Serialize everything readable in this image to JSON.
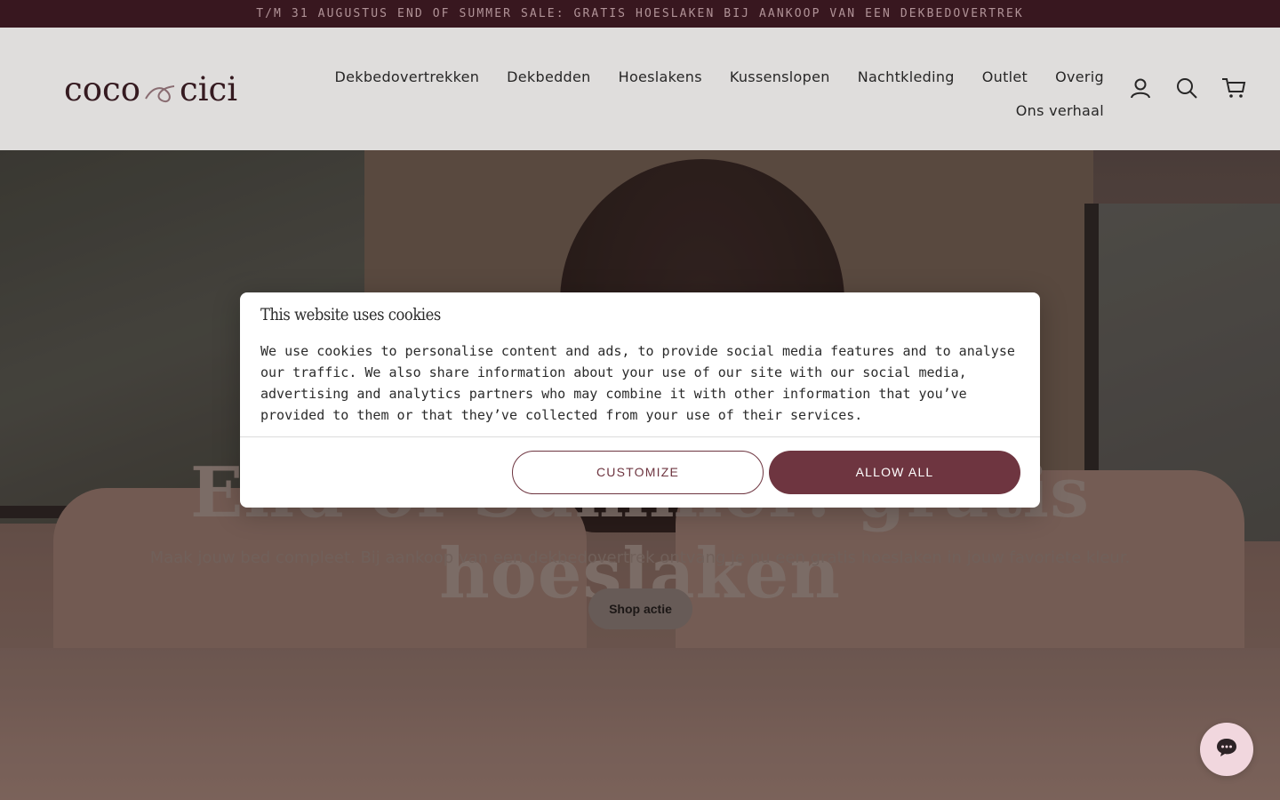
{
  "announcement": {
    "text": "T/M 31 AUGUSTUS END OF SUMMER SALE: GRATIS HOESLAKEN BIJ AANKOOP VAN EEN DEKBEDOVERTREK"
  },
  "header": {
    "logo": {
      "part1": "coco",
      "part2": "cici",
      "ampersand_icon": "ampersand-icon"
    },
    "nav_row1": [
      {
        "label": "Dekbedovertrekken"
      },
      {
        "label": "Dekbedden"
      },
      {
        "label": "Hoeslakens"
      },
      {
        "label": "Kussenslopen"
      },
      {
        "label": "Nachtkleding"
      },
      {
        "label": "Outlet"
      },
      {
        "label": "Overig"
      }
    ],
    "nav_row2": [
      {
        "label": "Ons verhaal"
      }
    ],
    "icons": [
      "account-icon",
      "search-icon",
      "cart-icon"
    ]
  },
  "hero": {
    "title": "End of Summer: gratis hoeslaken",
    "subtitle": "Maak jouw bed compleet. Bij aankoop van een dekbedovertrek ontvang je nu een gratis hoeslaken in jouw favoriete kleur.",
    "cta": "Shop actie"
  },
  "cookie_dialog": {
    "title": "This website uses cookies",
    "body": "We use cookies to personalise content and ads, to provide social media features and to analyse our traffic. We also share information about your use of our site with our social media, advertising and analytics partners who may combine it with other information that you’ve provided to them or that they’ve collected from your use of their services.",
    "customize_label": "CUSTOMIZE",
    "allow_label": "ALLOW ALL"
  },
  "chat": {
    "icon": "chat-icon"
  },
  "colors": {
    "brand": "#6e3540",
    "announcement_bg": "#3e1a23",
    "header_bg": "#fcfbfa"
  }
}
